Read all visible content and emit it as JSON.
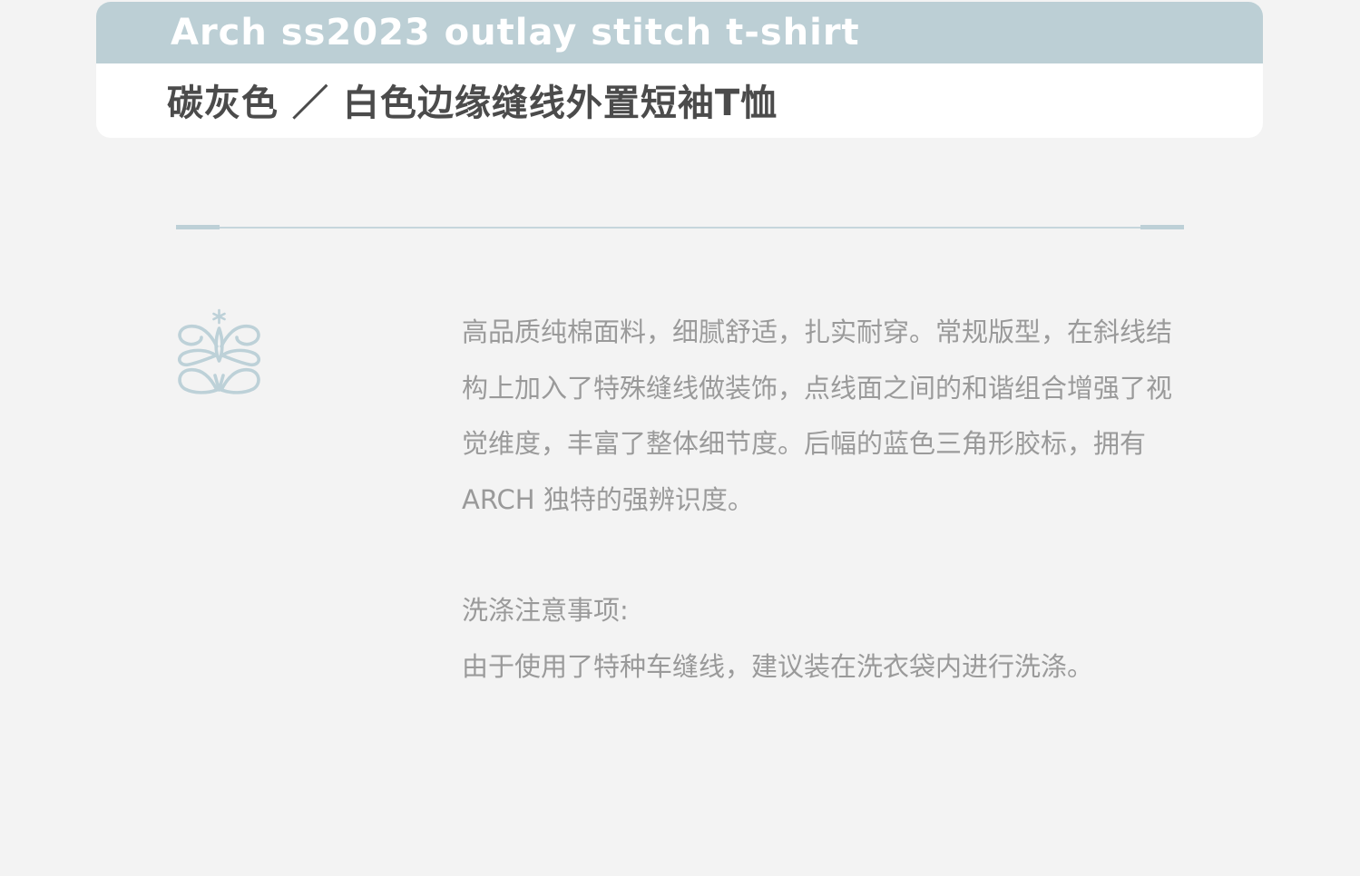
{
  "header": {
    "title_en": "Arch ss2023 outlay stitch t-shirt",
    "title_cn": "碳灰色 ／ 白色边缘缝线外置短袖T恤"
  },
  "emblem": {
    "icon": "butterfly-logo-icon"
  },
  "description": {
    "text": "高品质纯棉面料，细腻舒适，扎实耐穿。常规版型，在斜线结构上加入了特殊缝线做装饰，点线面之间的和谐组合增强了视觉维度，丰富了整体细节度。后幅的蓝色三角形胶标，拥有 ARCH 独特的强辨识度。"
  },
  "care": {
    "title": "洗涤注意事项:",
    "text": "由于使用了特种车缝线，建议装在洗衣袋内进行洗涤。"
  },
  "colors": {
    "accent": "#bccfd5",
    "title_text": "#4b4b4b",
    "body_text": "#9a9a9a",
    "background": "#f3f3f3"
  }
}
